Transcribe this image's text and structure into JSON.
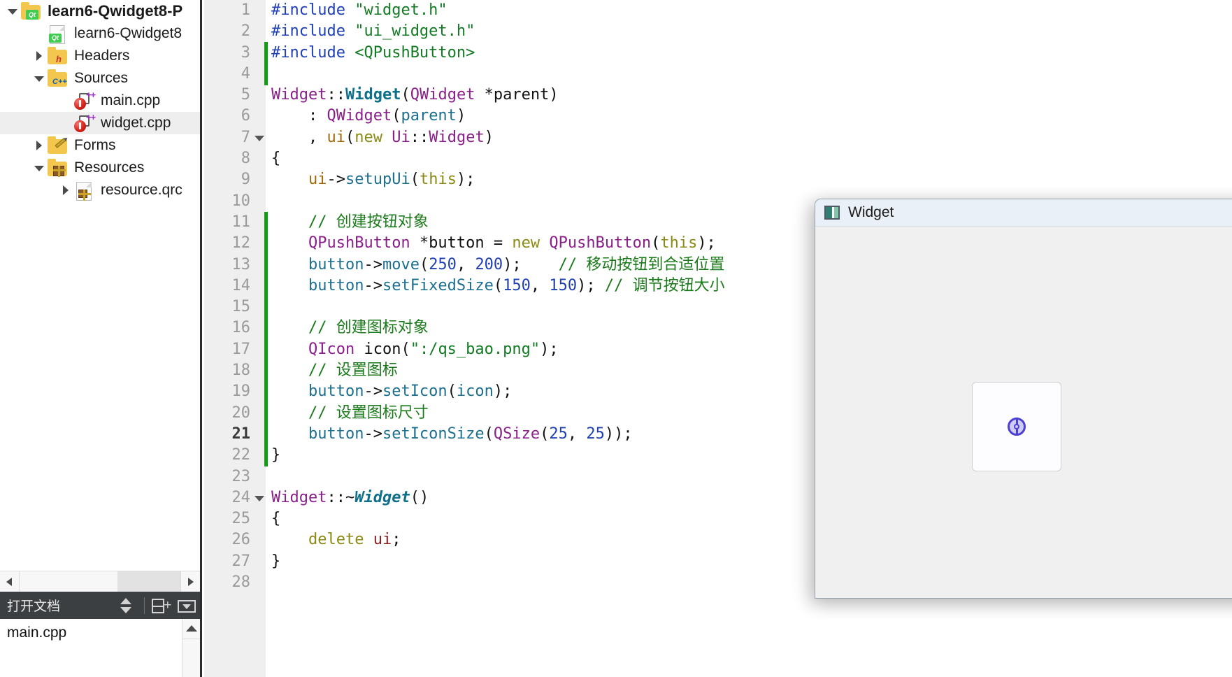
{
  "project_tree": {
    "items": [
      {
        "label": "learn6-Qwidget8-P",
        "icon": "qt-project-folder-icon",
        "twisty": "down",
        "indent": 0,
        "bold": true,
        "selected": false,
        "icon_type": "folder-qt"
      },
      {
        "label": "learn6-Qwidget8",
        "icon": "qt-project-file-icon",
        "twisty": "none",
        "indent": 1,
        "bold": false,
        "selected": false,
        "icon_type": "page-qt"
      },
      {
        "label": "Headers",
        "icon": "headers-folder-icon",
        "twisty": "right",
        "indent": 1,
        "bold": false,
        "selected": false,
        "icon_type": "folder-h"
      },
      {
        "label": "Sources",
        "icon": "sources-folder-icon",
        "twisty": "down",
        "indent": 1,
        "bold": false,
        "selected": false,
        "icon_type": "folder-cpp"
      },
      {
        "label": "main.cpp",
        "icon": "cpp-source-file-icon",
        "twisty": "none",
        "indent": 2,
        "bold": false,
        "selected": false,
        "icon_type": "cppfile"
      },
      {
        "label": "widget.cpp",
        "icon": "cpp-source-file-icon",
        "twisty": "none",
        "indent": 2,
        "bold": false,
        "selected": true,
        "icon_type": "cppfile"
      },
      {
        "label": "Forms",
        "icon": "forms-folder-icon",
        "twisty": "right",
        "indent": 1,
        "bold": false,
        "selected": false,
        "icon_type": "folder-forms"
      },
      {
        "label": "Resources",
        "icon": "resources-folder-icon",
        "twisty": "down",
        "indent": 1,
        "bold": false,
        "selected": false,
        "icon_type": "folder-res"
      },
      {
        "label": "resource.qrc",
        "icon": "qrc-file-icon",
        "twisty": "right",
        "indent": 2,
        "bold": false,
        "selected": false,
        "icon_type": "page-res"
      }
    ]
  },
  "open_documents": {
    "title": "打开文档",
    "toolbar": [
      {
        "name": "sort-order-icon",
        "glyph": "sort"
      },
      {
        "name": "split-add-icon",
        "glyph": "splitplus"
      },
      {
        "name": "close-dropdown-icon",
        "glyph": "dropbox"
      }
    ],
    "items": [
      {
        "label": "main.cpp"
      }
    ]
  },
  "editor": {
    "filename": "widget.cpp",
    "current_line": 21,
    "lines": [
      {
        "n": 1,
        "fold": false,
        "tokens": [
          {
            "t": "#include ",
            "c": "k-pre"
          },
          {
            "t": "\"widget.h\"",
            "c": "k-str"
          }
        ]
      },
      {
        "n": 2,
        "fold": false,
        "tokens": [
          {
            "t": "#include ",
            "c": "k-pre"
          },
          {
            "t": "\"ui_widget.h\"",
            "c": "k-str"
          }
        ]
      },
      {
        "n": 3,
        "fold": false,
        "tokens": [
          {
            "t": "#include ",
            "c": "k-pre"
          },
          {
            "t": "<QPushButton>",
            "c": "k-str"
          }
        ]
      },
      {
        "n": 4,
        "fold": false,
        "tokens": []
      },
      {
        "n": 5,
        "fold": false,
        "tokens": [
          {
            "t": "Widget",
            "c": "k-cls"
          },
          {
            "t": "::",
            "c": "k-plain"
          },
          {
            "t": "Widget",
            "c": "k-ctor"
          },
          {
            "t": "(",
            "c": "k-plain"
          },
          {
            "t": "QWidget",
            "c": "k-cls"
          },
          {
            "t": " *parent)",
            "c": "k-plain"
          }
        ]
      },
      {
        "n": 6,
        "fold": false,
        "tokens": [
          {
            "t": "    : ",
            "c": "k-plain"
          },
          {
            "t": "QWidget",
            "c": "k-cls"
          },
          {
            "t": "(",
            "c": "k-plain"
          },
          {
            "t": "parent",
            "c": "k-fn2"
          },
          {
            "t": ")",
            "c": "k-plain"
          }
        ]
      },
      {
        "n": 7,
        "fold": true,
        "tokens": [
          {
            "t": "    , ",
            "c": "k-plain"
          },
          {
            "t": "ui",
            "c": "k-field"
          },
          {
            "t": "(",
            "c": "k-plain"
          },
          {
            "t": "new ",
            "c": "k-kw"
          },
          {
            "t": "Ui",
            "c": "k-cls"
          },
          {
            "t": "::",
            "c": "k-plain"
          },
          {
            "t": "Widget",
            "c": "k-cls"
          },
          {
            "t": ")",
            "c": "k-plain"
          }
        ]
      },
      {
        "n": 8,
        "fold": false,
        "tokens": [
          {
            "t": "{",
            "c": "k-plain"
          }
        ]
      },
      {
        "n": 9,
        "fold": false,
        "tokens": [
          {
            "t": "    ",
            "c": "k-plain"
          },
          {
            "t": "ui",
            "c": "k-field"
          },
          {
            "t": "->",
            "c": "k-plain"
          },
          {
            "t": "setupUi",
            "c": "k-fn2"
          },
          {
            "t": "(",
            "c": "k-plain"
          },
          {
            "t": "this",
            "c": "k-this"
          },
          {
            "t": ");",
            "c": "k-plain"
          }
        ]
      },
      {
        "n": 10,
        "fold": false,
        "tokens": []
      },
      {
        "n": 11,
        "fold": false,
        "tokens": [
          {
            "t": "    // 创建按钮对象",
            "c": "k-cmt"
          }
        ]
      },
      {
        "n": 12,
        "fold": false,
        "tokens": [
          {
            "t": "    ",
            "c": "k-plain"
          },
          {
            "t": "QPushButton",
            "c": "k-cls"
          },
          {
            "t": " *button = ",
            "c": "k-plain"
          },
          {
            "t": "new ",
            "c": "k-kw"
          },
          {
            "t": "QPushButton",
            "c": "k-cls"
          },
          {
            "t": "(",
            "c": "k-plain"
          },
          {
            "t": "this",
            "c": "k-this"
          },
          {
            "t": ");",
            "c": "k-plain"
          }
        ]
      },
      {
        "n": 13,
        "fold": false,
        "tokens": [
          {
            "t": "    button",
            "c": "k-fn2"
          },
          {
            "t": "->",
            "c": "k-plain"
          },
          {
            "t": "move",
            "c": "k-fn2"
          },
          {
            "t": "(",
            "c": "k-plain"
          },
          {
            "t": "250",
            "c": "k-num"
          },
          {
            "t": ", ",
            "c": "k-plain"
          },
          {
            "t": "200",
            "c": "k-num"
          },
          {
            "t": ");    ",
            "c": "k-plain"
          },
          {
            "t": "// 移动按钮到合适位置",
            "c": "k-cmt"
          }
        ]
      },
      {
        "n": 14,
        "fold": false,
        "tokens": [
          {
            "t": "    button",
            "c": "k-fn2"
          },
          {
            "t": "->",
            "c": "k-plain"
          },
          {
            "t": "setFixedSize",
            "c": "k-fn2"
          },
          {
            "t": "(",
            "c": "k-plain"
          },
          {
            "t": "150",
            "c": "k-num"
          },
          {
            "t": ", ",
            "c": "k-plain"
          },
          {
            "t": "150",
            "c": "k-num"
          },
          {
            "t": "); ",
            "c": "k-plain"
          },
          {
            "t": "// 调节按钮大小",
            "c": "k-cmt"
          }
        ]
      },
      {
        "n": 15,
        "fold": false,
        "tokens": []
      },
      {
        "n": 16,
        "fold": false,
        "tokens": [
          {
            "t": "    // 创建图标对象",
            "c": "k-cmt"
          }
        ]
      },
      {
        "n": 17,
        "fold": false,
        "tokens": [
          {
            "t": "    ",
            "c": "k-plain"
          },
          {
            "t": "QIcon",
            "c": "k-cls"
          },
          {
            "t": " icon(",
            "c": "k-plain"
          },
          {
            "t": "\":/qs_bao.png\"",
            "c": "k-str"
          },
          {
            "t": ");",
            "c": "k-plain"
          }
        ]
      },
      {
        "n": 18,
        "fold": false,
        "tokens": [
          {
            "t": "    // 设置图标",
            "c": "k-cmt"
          }
        ]
      },
      {
        "n": 19,
        "fold": false,
        "tokens": [
          {
            "t": "    button",
            "c": "k-fn2"
          },
          {
            "t": "->",
            "c": "k-plain"
          },
          {
            "t": "setIcon",
            "c": "k-fn2"
          },
          {
            "t": "(",
            "c": "k-plain"
          },
          {
            "t": "icon",
            "c": "k-fn2"
          },
          {
            "t": ");",
            "c": "k-plain"
          }
        ]
      },
      {
        "n": 20,
        "fold": false,
        "tokens": [
          {
            "t": "    // 设置图标尺寸",
            "c": "k-cmt"
          }
        ]
      },
      {
        "n": 21,
        "fold": false,
        "tokens": [
          {
            "t": "    button",
            "c": "k-fn2"
          },
          {
            "t": "->",
            "c": "k-plain"
          },
          {
            "t": "setIconSize",
            "c": "k-fn2"
          },
          {
            "t": "(",
            "c": "k-plain"
          },
          {
            "t": "QSize",
            "c": "k-cls"
          },
          {
            "t": "(",
            "c": "k-plain"
          },
          {
            "t": "25",
            "c": "k-num"
          },
          {
            "t": ", ",
            "c": "k-plain"
          },
          {
            "t": "25",
            "c": "k-num"
          },
          {
            "t": "));",
            "c": "k-plain"
          }
        ]
      },
      {
        "n": 22,
        "fold": false,
        "tokens": [
          {
            "t": "}",
            "c": "k-plain"
          }
        ]
      },
      {
        "n": 23,
        "fold": false,
        "tokens": []
      },
      {
        "n": 24,
        "fold": true,
        "tokens": [
          {
            "t": "Widget",
            "c": "k-cls"
          },
          {
            "t": "::~",
            "c": "k-plain"
          },
          {
            "t": "Widget",
            "c": "k-dtor"
          },
          {
            "t": "()",
            "c": "k-plain"
          }
        ]
      },
      {
        "n": 25,
        "fold": false,
        "tokens": [
          {
            "t": "{",
            "c": "k-plain"
          }
        ]
      },
      {
        "n": 26,
        "fold": false,
        "tokens": [
          {
            "t": "    delete ",
            "c": "k-kw"
          },
          {
            "t": "ui",
            "c": "k-var"
          },
          {
            "t": ";",
            "c": "k-plain"
          }
        ]
      },
      {
        "n": 27,
        "fold": false,
        "tokens": [
          {
            "t": "}",
            "c": "k-plain"
          }
        ]
      },
      {
        "n": 28,
        "fold": false,
        "tokens": []
      }
    ]
  },
  "widget_window": {
    "title": "Widget",
    "button": {
      "icon_name": "qs-bao-icon"
    }
  },
  "colors": {
    "comment_green": "#1a7a1a",
    "string_green": "#127a22",
    "preprocessor_blue": "#1f3fb5",
    "class_purple": "#8a1f8a",
    "keyword_olive": "#8a8a14",
    "changebar_green": "#159c16",
    "titlebar_blue": "#eaf0f8",
    "opendocs_dark": "#3b3f41",
    "button_icon_purple": "#4b3fd4"
  }
}
